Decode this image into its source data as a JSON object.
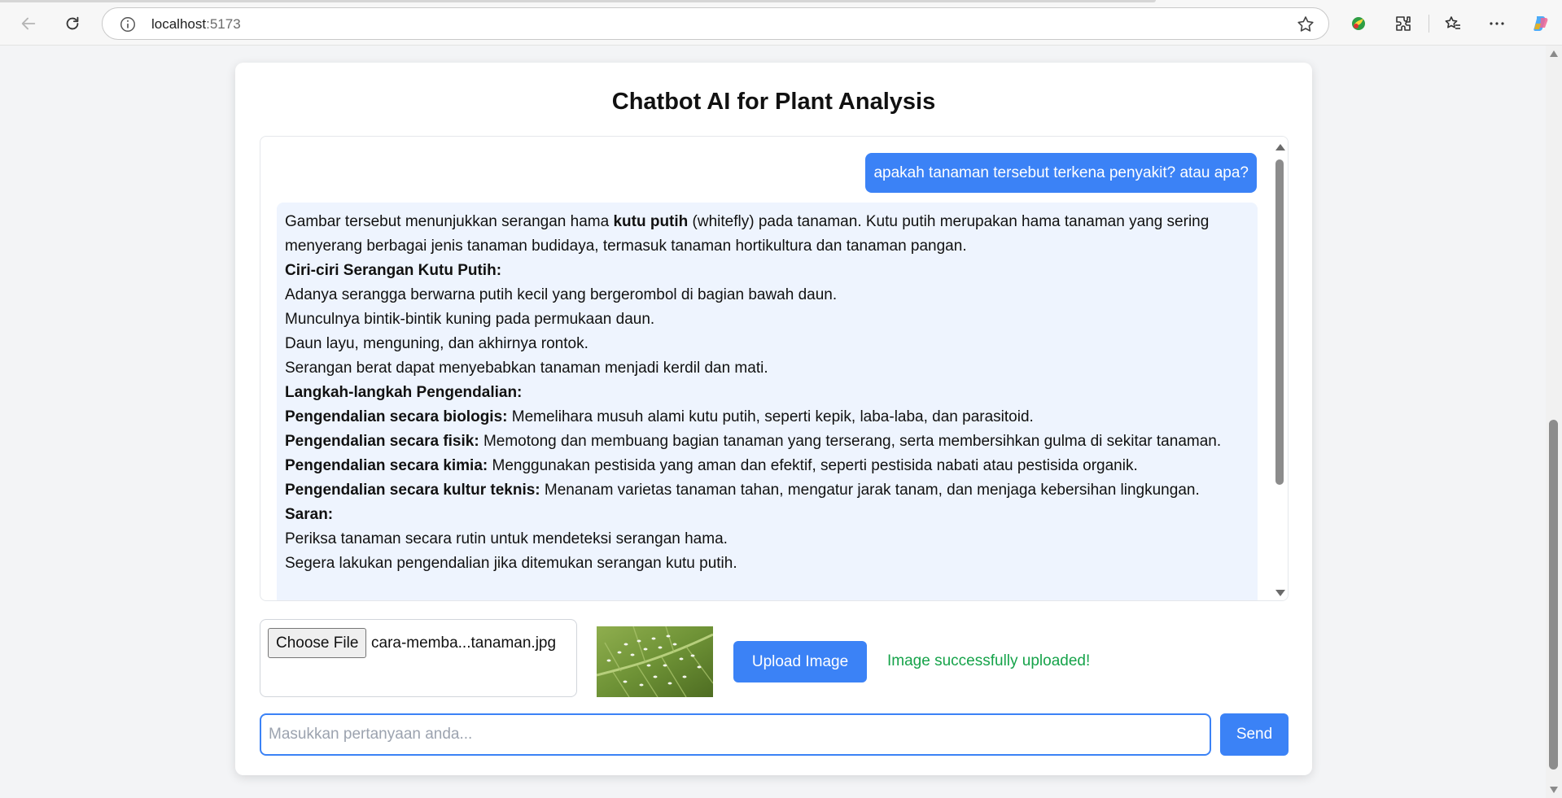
{
  "browser": {
    "url_host": "localhost",
    "url_port": ":5173"
  },
  "page": {
    "title": "Chatbot AI for Plant Analysis"
  },
  "chat": {
    "user_message": "apakah tanaman tersebut terkena penyakit? atau apa?",
    "bot_message": {
      "intro_prefix": "Gambar tersebut menunjukkan serangan hama ",
      "intro_bold": "kutu putih",
      "intro_suffix": " (whitefly) pada tanaman. Kutu putih merupakan hama tanaman yang sering menyerang berbagai jenis tanaman budidaya, termasuk tanaman hortikultura dan tanaman pangan.",
      "symptoms_heading": "Ciri-ciri Serangan Kutu Putih:",
      "symptoms": [
        "Adanya serangga berwarna putih kecil yang bergerombol di bagian bawah daun.",
        "Munculnya bintik-bintik kuning pada permukaan daun.",
        "Daun layu, menguning, dan akhirnya rontok.",
        "Serangan berat dapat menyebabkan tanaman menjadi kerdil dan mati."
      ],
      "control_heading": "Langkah-langkah Pengendalian:",
      "controls": [
        {
          "label": "Pengendalian secara biologis:",
          "text": " Memelihara musuh alami kutu putih, seperti kepik, laba-laba, dan parasitoid."
        },
        {
          "label": "Pengendalian secara fisik:",
          "text": " Memotong dan membuang bagian tanaman yang terserang, serta membersihkan gulma di sekitar tanaman."
        },
        {
          "label": "Pengendalian secara kimia:",
          "text": " Menggunakan pestisida yang aman dan efektif, seperti pestisida nabati atau pestisida organik."
        },
        {
          "label": "Pengendalian secara kultur teknis:",
          "text": " Menanam varietas tanaman tahan, mengatur jarak tanam, dan menjaga kebersihan lingkungan."
        }
      ],
      "advice_heading": "Saran:",
      "advice": [
        "Periksa tanaman secara rutin untuk mendeteksi serangan hama.",
        "Segera lakukan pengendalian jika ditemukan serangan kutu putih."
      ]
    }
  },
  "upload": {
    "choose_label": "Choose File",
    "file_name": "cara-memba...tanaman.jpg",
    "upload_label": "Upload Image",
    "status": "Image successfully uploaded!"
  },
  "composer": {
    "placeholder": "Masukkan pertanyaan anda...",
    "value": "",
    "send_label": "Send"
  },
  "colors": {
    "accent": "#3b82f6",
    "bot_bubble": "#eef4fe",
    "success": "#16a34a"
  },
  "icons": [
    "back-arrow-icon",
    "reload-icon",
    "info-icon",
    "star-icon",
    "copilot-leaf-icon",
    "extensions-icon",
    "favorites-icon",
    "more-icon",
    "copilot-icon"
  ]
}
